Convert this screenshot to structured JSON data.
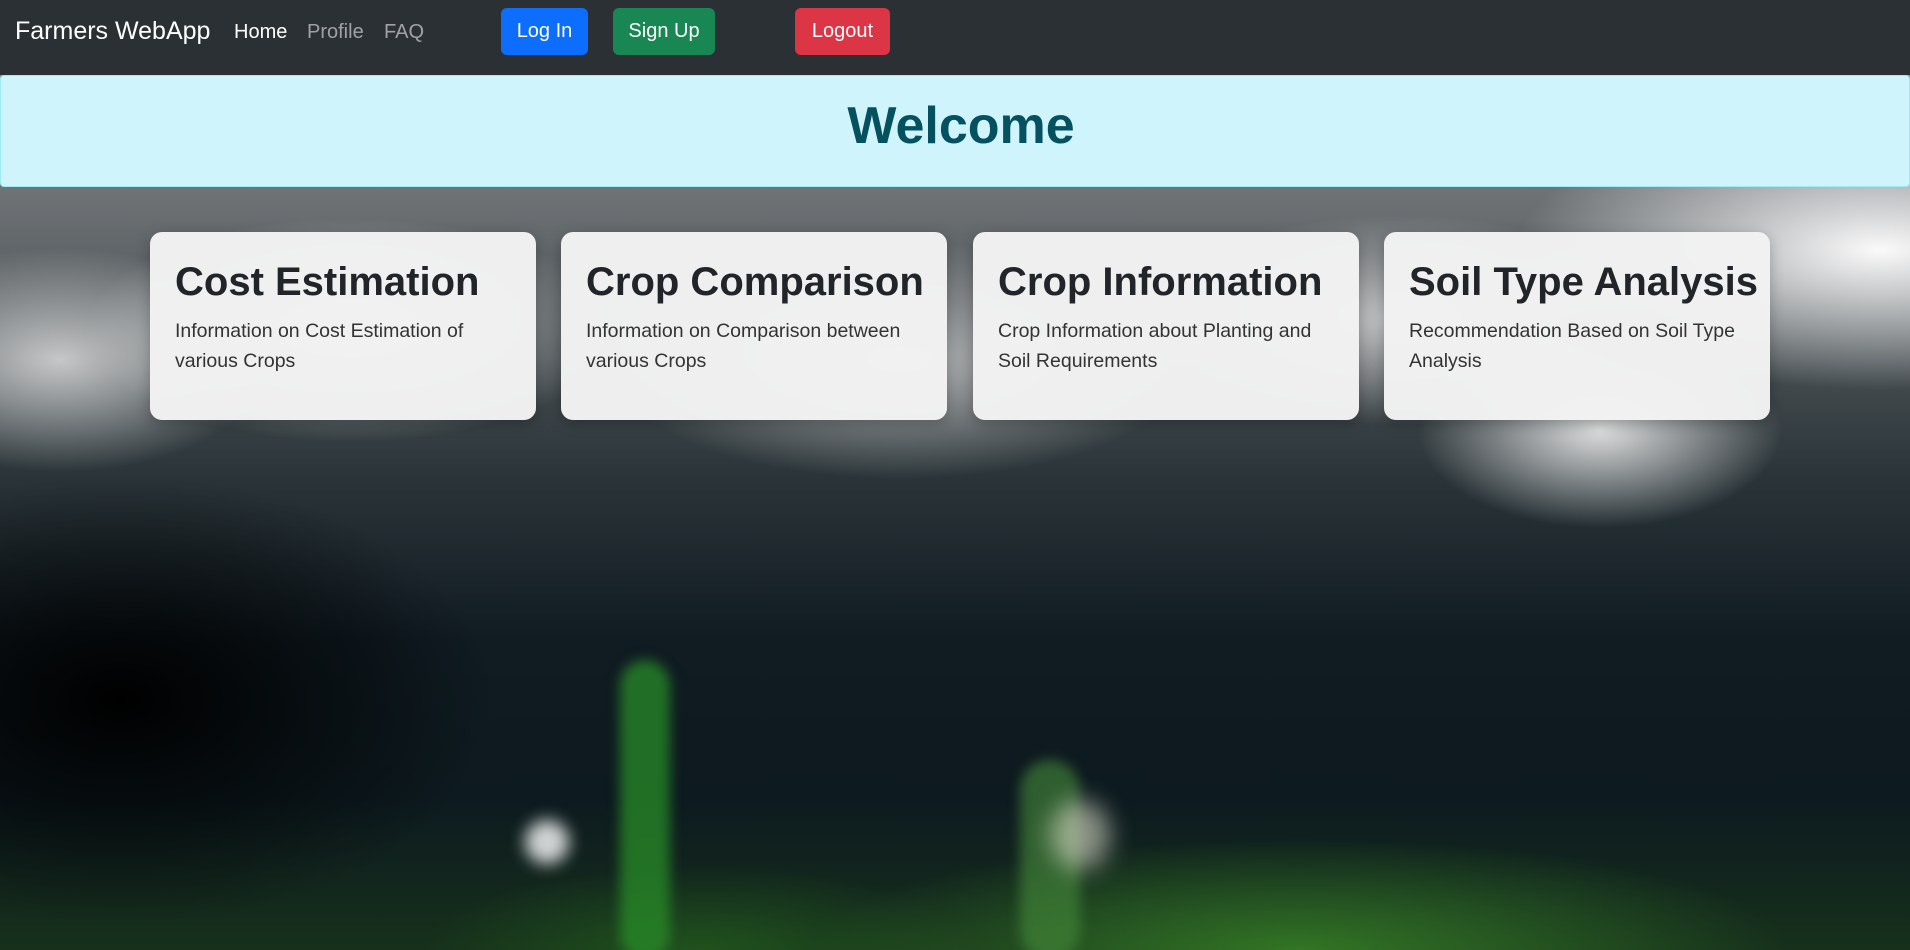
{
  "navbar": {
    "brand": "Farmers WebApp",
    "links": [
      {
        "label": "Home",
        "active": true
      },
      {
        "label": "Profile",
        "active": false
      },
      {
        "label": "FAQ",
        "active": false
      }
    ],
    "buttons": {
      "login": "Log In",
      "signup": "Sign Up",
      "logout": "Logout"
    }
  },
  "welcome": {
    "title": "Welcome"
  },
  "cards": [
    {
      "title": "Cost Estimation",
      "text": "Information on Cost Estimation of various Crops"
    },
    {
      "title": "Crop Comparison",
      "text": "Information on Comparison between various Crops"
    },
    {
      "title": "Crop Information",
      "text": "Crop Information about Planting and Soil Requirements"
    },
    {
      "title": "Soil Type Analysis",
      "text": "Recommendation Based on Soil Type Analysis"
    }
  ],
  "colors": {
    "navbar_bg": "#2b3035",
    "login_button": "#0d6efd",
    "signup_button": "#198754",
    "logout_button": "#dc3545",
    "welcome_bg": "#cff4fc",
    "welcome_text": "#055160"
  }
}
